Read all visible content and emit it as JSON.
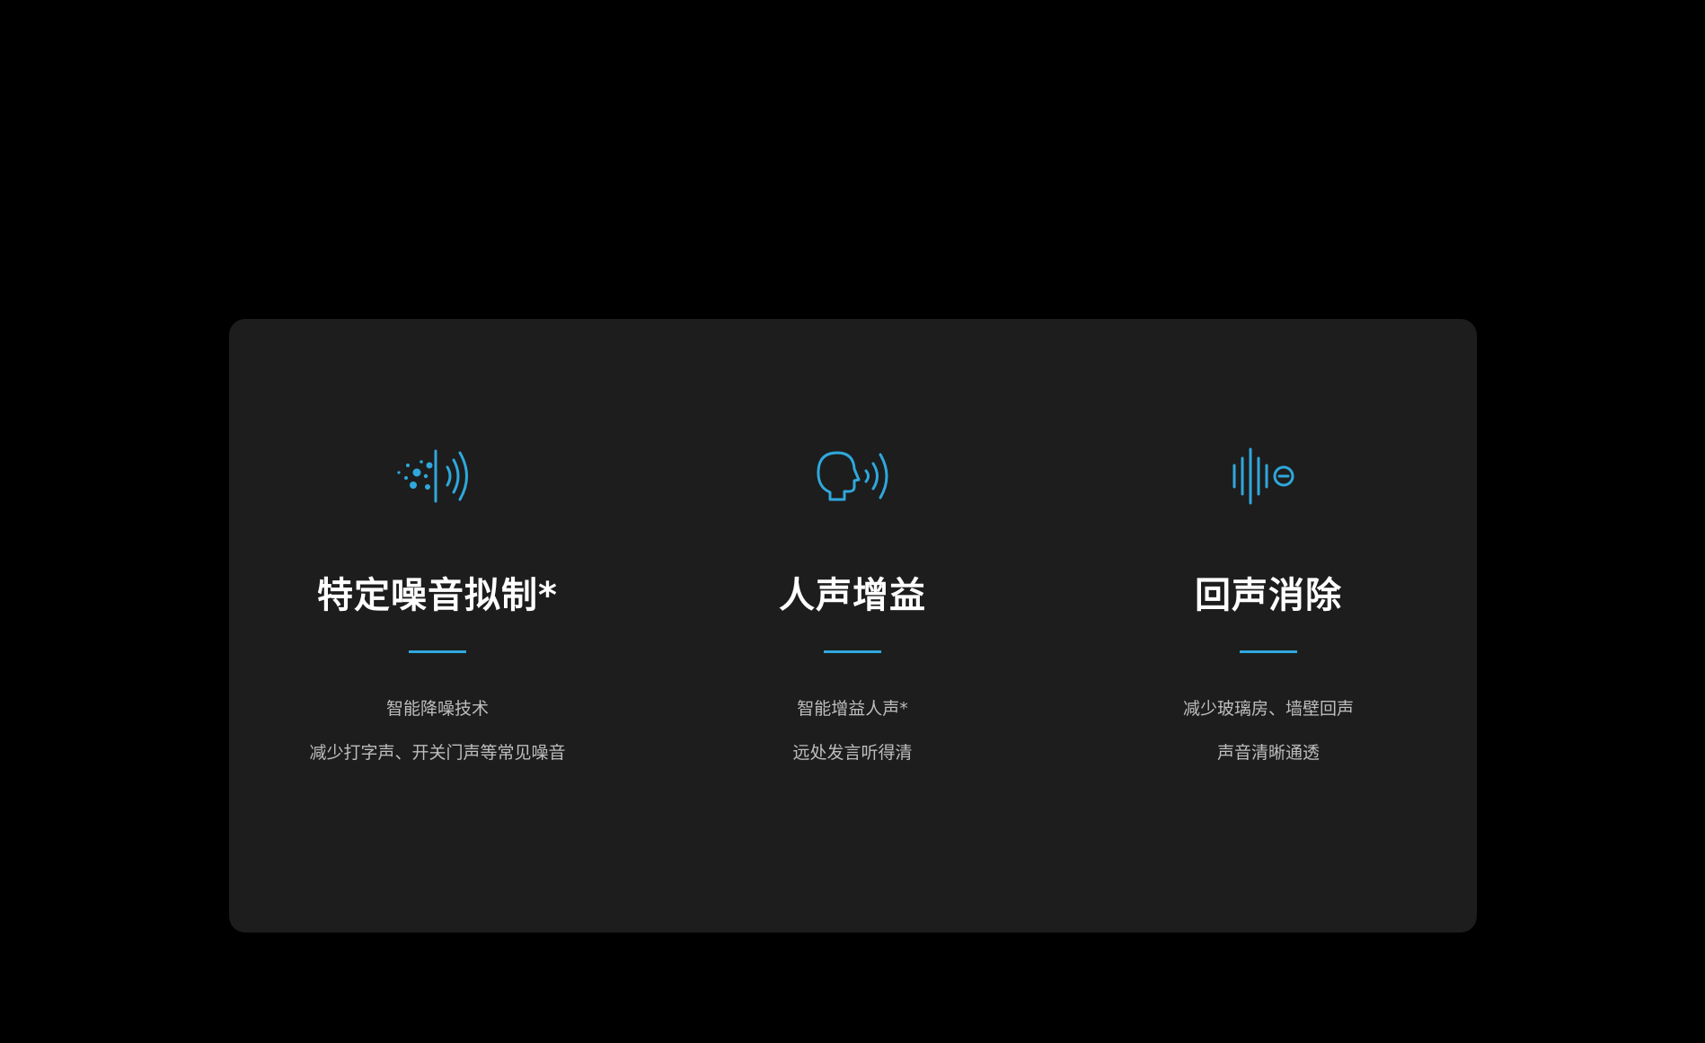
{
  "accent_color": "#2fa8dc",
  "features": [
    {
      "icon": "noise-suppression-icon",
      "title": "特定噪音拟制*",
      "lines": [
        "智能降噪技术",
        "减少打字声、开关门声等常见噪音"
      ]
    },
    {
      "icon": "voice-enhancement-icon",
      "title": "人声增益",
      "lines": [
        "智能增益人声*",
        "远处发言听得清"
      ]
    },
    {
      "icon": "echo-cancellation-icon",
      "title": "回声消除",
      "lines": [
        "减少玻璃房、墙壁回声",
        "声音清晰通透"
      ]
    }
  ]
}
